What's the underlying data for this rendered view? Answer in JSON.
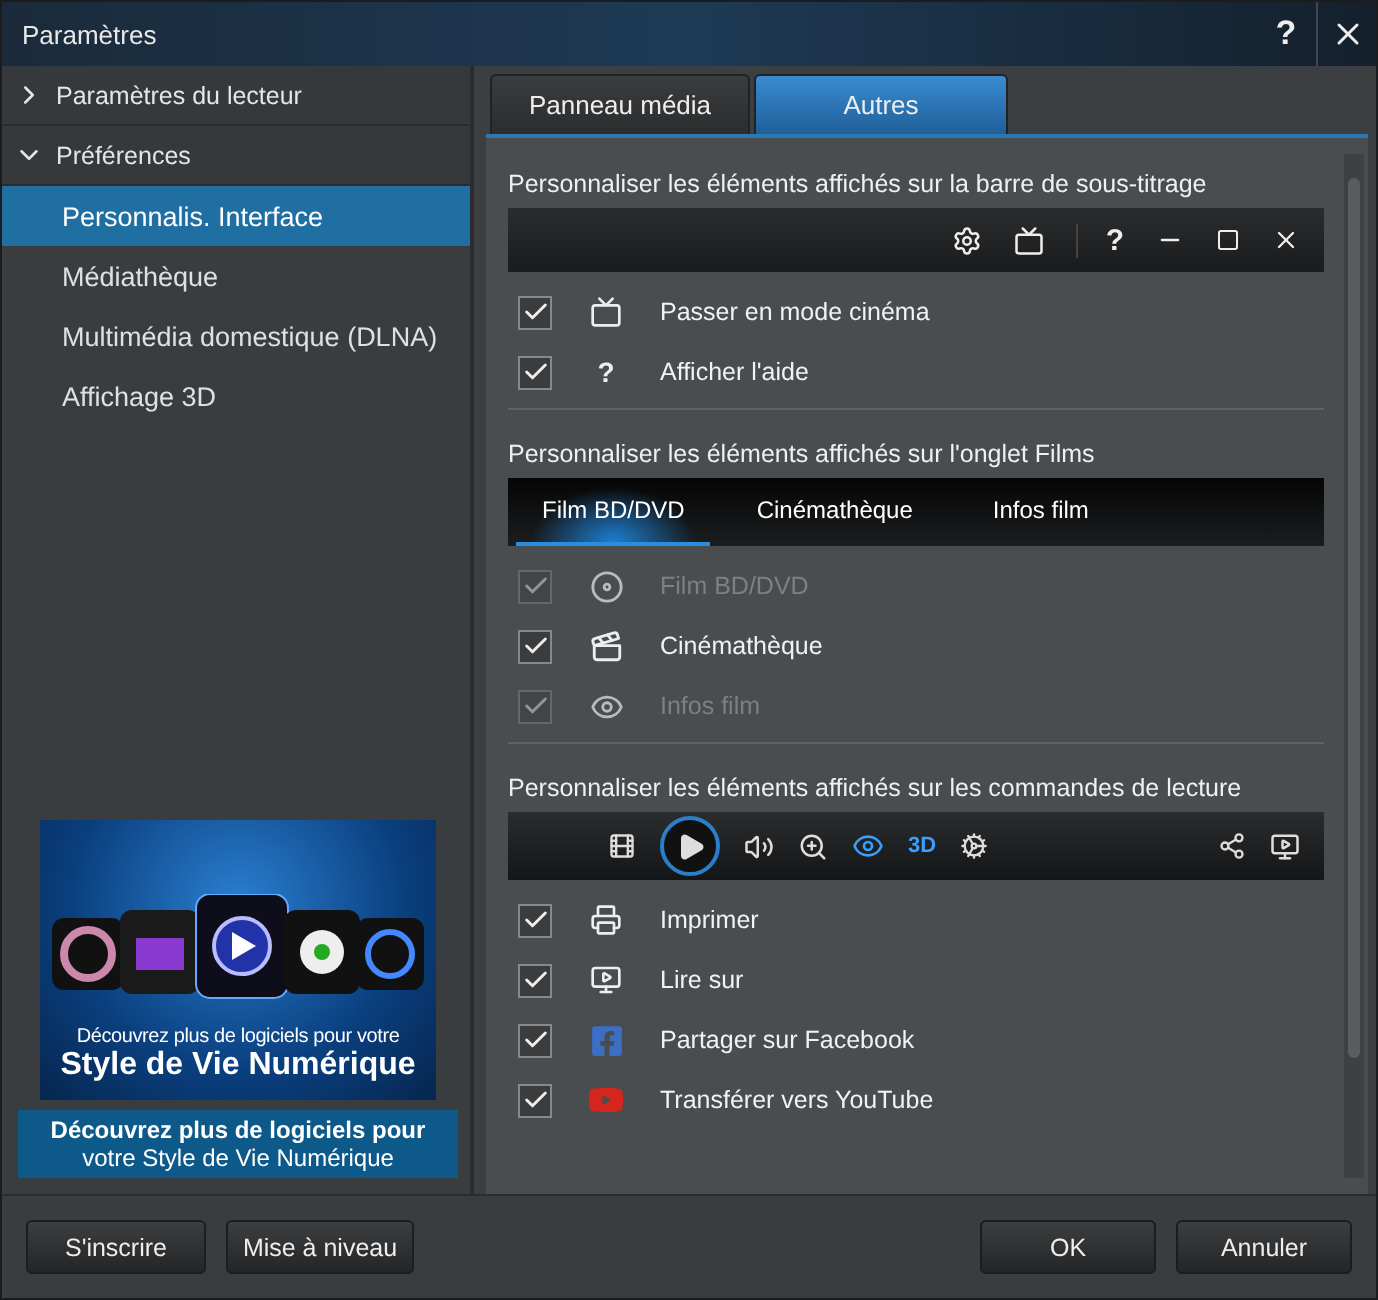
{
  "window": {
    "title": "Paramètres",
    "help": "?"
  },
  "sidebar": {
    "items": [
      {
        "label": "Paramètres du lecteur",
        "expanded": false
      },
      {
        "label": "Préférences",
        "expanded": true,
        "children": [
          {
            "label": "Personnalis. Interface",
            "selected": true
          },
          {
            "label": "Médiathèque",
            "selected": false
          },
          {
            "label": "Multimédia domestique (DLNA)",
            "selected": false
          },
          {
            "label": "Affichage 3D",
            "selected": false
          }
        ]
      }
    ]
  },
  "banner": {
    "line1": "Découvrez plus de logiciels pour votre",
    "line2": "Style de Vie Numérique",
    "caption_bold": "Découvrez plus de logiciels pour",
    "caption": "votre Style de Vie Numérique"
  },
  "tabs": [
    {
      "label": "Panneau média",
      "selected": false
    },
    {
      "label": "Autres",
      "selected": true
    }
  ],
  "sections": [
    {
      "title": "Personnaliser les éléments affichés sur la barre de sous-titrage",
      "bar": {
        "kind": "window",
        "help": "?"
      },
      "items": [
        {
          "kind": "tv",
          "label": "Passer en mode cinéma",
          "checked": true,
          "disabled": false
        },
        {
          "kind": "help",
          "glyph": "?",
          "label": "Afficher l'aide",
          "checked": true,
          "disabled": false
        }
      ]
    },
    {
      "title": "Personnaliser les éléments affichés sur l'onglet Films",
      "bar": {
        "kind": "tabs",
        "tabs": [
          {
            "label": "Film BD/DVD",
            "selected": true
          },
          {
            "label": "Cinémathèque",
            "selected": false
          },
          {
            "label": "Infos film",
            "selected": false
          }
        ]
      },
      "items": [
        {
          "kind": "disc",
          "label": "Film BD/DVD",
          "checked": true,
          "disabled": true
        },
        {
          "kind": "clapper",
          "label": "Cinémathèque",
          "checked": true,
          "disabled": false
        },
        {
          "kind": "eyes",
          "label": "Infos film",
          "checked": true,
          "disabled": true
        }
      ]
    },
    {
      "title": "Personnaliser les éléments affichés sur les commandes de lecture",
      "bar": {
        "kind": "player",
        "three_d": "3D"
      },
      "items": [
        {
          "kind": "printer",
          "label": "Imprimer",
          "checked": true,
          "disabled": false
        },
        {
          "kind": "screen",
          "label": "Lire sur",
          "checked": true,
          "disabled": false
        },
        {
          "kind": "facebook",
          "label": "Partager sur Facebook",
          "checked": true,
          "disabled": false
        },
        {
          "kind": "youtube",
          "label": "Transférer vers YouTube",
          "checked": true,
          "disabled": false
        }
      ]
    }
  ],
  "footer": {
    "left": [
      "S'inscrire",
      "Mise à niveau"
    ],
    "right": [
      "OK",
      "Annuler"
    ]
  }
}
